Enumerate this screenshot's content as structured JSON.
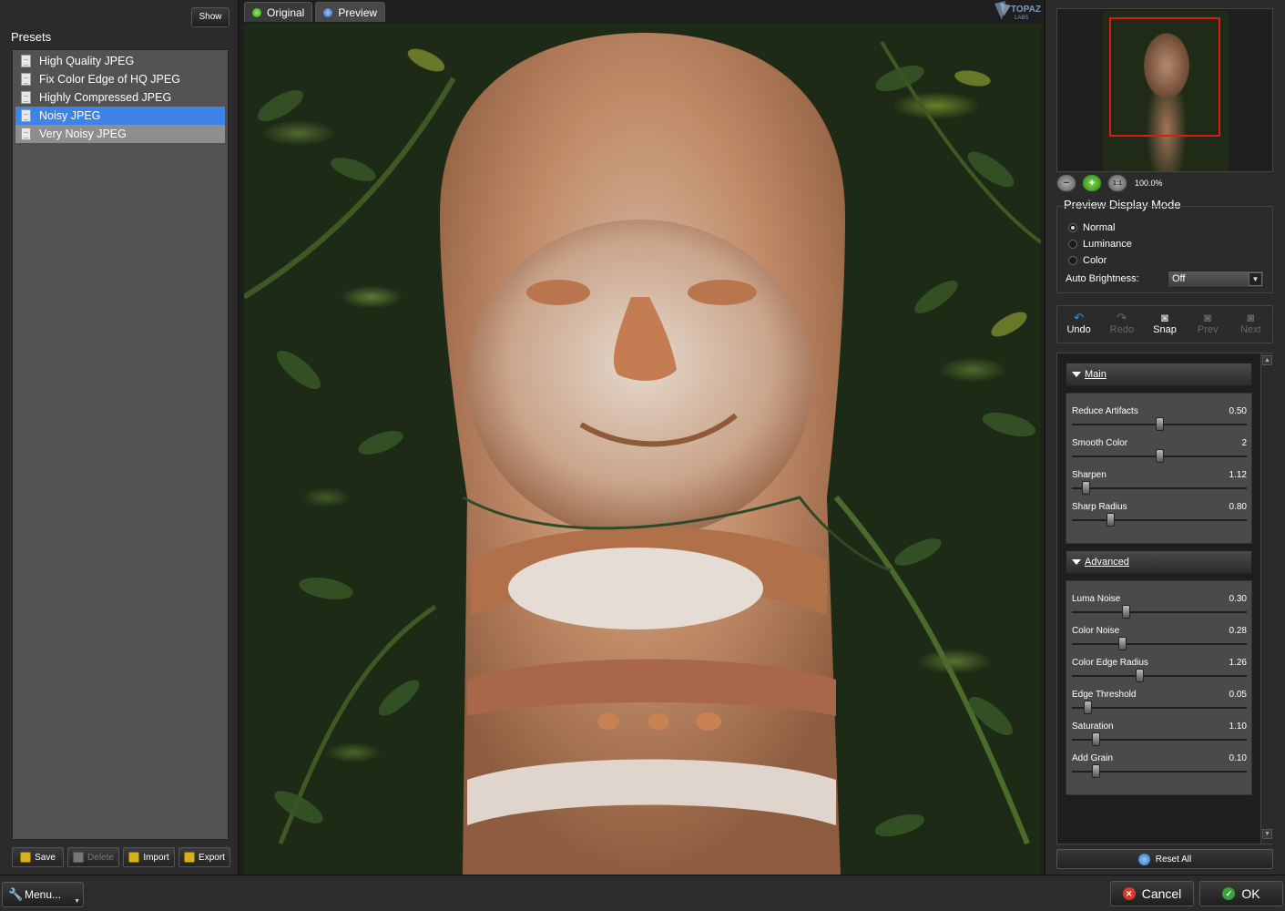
{
  "left_panel": {
    "show_label": "Show",
    "presets_title": "Presets",
    "presets": [
      {
        "label": "High Quality JPEG"
      },
      {
        "label": "Fix Color Edge of HQ JPEG"
      },
      {
        "label": "Highly Compressed JPEG"
      },
      {
        "label": "Noisy JPEG"
      },
      {
        "label": "Very Noisy JPEG"
      }
    ],
    "buttons": {
      "save": "Save",
      "delete": "Delete",
      "import": "Import",
      "export": "Export"
    }
  },
  "tabs": {
    "original": "Original",
    "preview": "Preview"
  },
  "brand": {
    "logo_text": "TOPAZ LABS"
  },
  "navigator": {
    "zoom_level": "100.0%"
  },
  "display_mode": {
    "title": "Preview Display Mode",
    "options": [
      {
        "label": "Normal",
        "selected": true
      },
      {
        "label": "Luminance",
        "selected": false
      },
      {
        "label": "Color",
        "selected": false
      }
    ],
    "auto_brightness_label": "Auto Brightness:",
    "auto_brightness_value": "Off"
  },
  "toolbar": {
    "undo": "Undo",
    "redo": "Redo",
    "snap": "Snap",
    "prev": "Prev",
    "next": "Next"
  },
  "main_section": {
    "title": "Main",
    "sliders": [
      {
        "label": "Reduce Artifacts",
        "value": "0.50",
        "fraction": 0.5
      },
      {
        "label": "Smooth Color",
        "value": "2",
        "fraction": 0.5
      },
      {
        "label": "Sharpen",
        "value": "1.12",
        "fraction": 0.06
      },
      {
        "label": "Sharp Radius",
        "value": "0.80",
        "fraction": 0.21
      }
    ]
  },
  "advanced_section": {
    "title": "Advanced",
    "sliders": [
      {
        "label": "Luma Noise",
        "value": "0.30",
        "fraction": 0.3
      },
      {
        "label": "Color Noise",
        "value": "0.28",
        "fraction": 0.28
      },
      {
        "label": "Color Edge Radius",
        "value": "1.26",
        "fraction": 0.38
      },
      {
        "label": "Edge Threshold",
        "value": "0.05",
        "fraction": 0.07
      },
      {
        "label": "Saturation",
        "value": "1.10",
        "fraction": 0.12
      },
      {
        "label": "Add Grain",
        "value": "0.10",
        "fraction": 0.12
      }
    ]
  },
  "reset_all": "Reset All",
  "bottom": {
    "menu": "Menu...",
    "cancel": "Cancel",
    "ok": "OK"
  }
}
